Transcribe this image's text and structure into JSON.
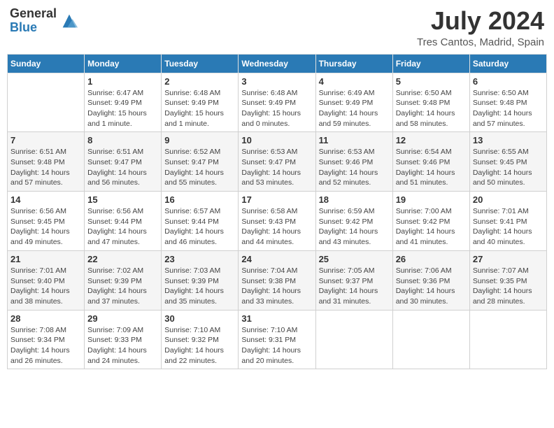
{
  "header": {
    "logo_general": "General",
    "logo_blue": "Blue",
    "month": "July 2024",
    "location": "Tres Cantos, Madrid, Spain"
  },
  "days_of_week": [
    "Sunday",
    "Monday",
    "Tuesday",
    "Wednesday",
    "Thursday",
    "Friday",
    "Saturday"
  ],
  "weeks": [
    [
      {
        "day": "",
        "content": ""
      },
      {
        "day": "1",
        "content": "Sunrise: 6:47 AM\nSunset: 9:49 PM\nDaylight: 15 hours\nand 1 minute."
      },
      {
        "day": "2",
        "content": "Sunrise: 6:48 AM\nSunset: 9:49 PM\nDaylight: 15 hours\nand 1 minute."
      },
      {
        "day": "3",
        "content": "Sunrise: 6:48 AM\nSunset: 9:49 PM\nDaylight: 15 hours\nand 0 minutes."
      },
      {
        "day": "4",
        "content": "Sunrise: 6:49 AM\nSunset: 9:49 PM\nDaylight: 14 hours\nand 59 minutes."
      },
      {
        "day": "5",
        "content": "Sunrise: 6:50 AM\nSunset: 9:48 PM\nDaylight: 14 hours\nand 58 minutes."
      },
      {
        "day": "6",
        "content": "Sunrise: 6:50 AM\nSunset: 9:48 PM\nDaylight: 14 hours\nand 57 minutes."
      }
    ],
    [
      {
        "day": "7",
        "content": "Sunrise: 6:51 AM\nSunset: 9:48 PM\nDaylight: 14 hours\nand 57 minutes."
      },
      {
        "day": "8",
        "content": "Sunrise: 6:51 AM\nSunset: 9:47 PM\nDaylight: 14 hours\nand 56 minutes."
      },
      {
        "day": "9",
        "content": "Sunrise: 6:52 AM\nSunset: 9:47 PM\nDaylight: 14 hours\nand 55 minutes."
      },
      {
        "day": "10",
        "content": "Sunrise: 6:53 AM\nSunset: 9:47 PM\nDaylight: 14 hours\nand 53 minutes."
      },
      {
        "day": "11",
        "content": "Sunrise: 6:53 AM\nSunset: 9:46 PM\nDaylight: 14 hours\nand 52 minutes."
      },
      {
        "day": "12",
        "content": "Sunrise: 6:54 AM\nSunset: 9:46 PM\nDaylight: 14 hours\nand 51 minutes."
      },
      {
        "day": "13",
        "content": "Sunrise: 6:55 AM\nSunset: 9:45 PM\nDaylight: 14 hours\nand 50 minutes."
      }
    ],
    [
      {
        "day": "14",
        "content": "Sunrise: 6:56 AM\nSunset: 9:45 PM\nDaylight: 14 hours\nand 49 minutes."
      },
      {
        "day": "15",
        "content": "Sunrise: 6:56 AM\nSunset: 9:44 PM\nDaylight: 14 hours\nand 47 minutes."
      },
      {
        "day": "16",
        "content": "Sunrise: 6:57 AM\nSunset: 9:44 PM\nDaylight: 14 hours\nand 46 minutes."
      },
      {
        "day": "17",
        "content": "Sunrise: 6:58 AM\nSunset: 9:43 PM\nDaylight: 14 hours\nand 44 minutes."
      },
      {
        "day": "18",
        "content": "Sunrise: 6:59 AM\nSunset: 9:42 PM\nDaylight: 14 hours\nand 43 minutes."
      },
      {
        "day": "19",
        "content": "Sunrise: 7:00 AM\nSunset: 9:42 PM\nDaylight: 14 hours\nand 41 minutes."
      },
      {
        "day": "20",
        "content": "Sunrise: 7:01 AM\nSunset: 9:41 PM\nDaylight: 14 hours\nand 40 minutes."
      }
    ],
    [
      {
        "day": "21",
        "content": "Sunrise: 7:01 AM\nSunset: 9:40 PM\nDaylight: 14 hours\nand 38 minutes."
      },
      {
        "day": "22",
        "content": "Sunrise: 7:02 AM\nSunset: 9:39 PM\nDaylight: 14 hours\nand 37 minutes."
      },
      {
        "day": "23",
        "content": "Sunrise: 7:03 AM\nSunset: 9:39 PM\nDaylight: 14 hours\nand 35 minutes."
      },
      {
        "day": "24",
        "content": "Sunrise: 7:04 AM\nSunset: 9:38 PM\nDaylight: 14 hours\nand 33 minutes."
      },
      {
        "day": "25",
        "content": "Sunrise: 7:05 AM\nSunset: 9:37 PM\nDaylight: 14 hours\nand 31 minutes."
      },
      {
        "day": "26",
        "content": "Sunrise: 7:06 AM\nSunset: 9:36 PM\nDaylight: 14 hours\nand 30 minutes."
      },
      {
        "day": "27",
        "content": "Sunrise: 7:07 AM\nSunset: 9:35 PM\nDaylight: 14 hours\nand 28 minutes."
      }
    ],
    [
      {
        "day": "28",
        "content": "Sunrise: 7:08 AM\nSunset: 9:34 PM\nDaylight: 14 hours\nand 26 minutes."
      },
      {
        "day": "29",
        "content": "Sunrise: 7:09 AM\nSunset: 9:33 PM\nDaylight: 14 hours\nand 24 minutes."
      },
      {
        "day": "30",
        "content": "Sunrise: 7:10 AM\nSunset: 9:32 PM\nDaylight: 14 hours\nand 22 minutes."
      },
      {
        "day": "31",
        "content": "Sunrise: 7:10 AM\nSunset: 9:31 PM\nDaylight: 14 hours\nand 20 minutes."
      },
      {
        "day": "",
        "content": ""
      },
      {
        "day": "",
        "content": ""
      },
      {
        "day": "",
        "content": ""
      }
    ]
  ]
}
